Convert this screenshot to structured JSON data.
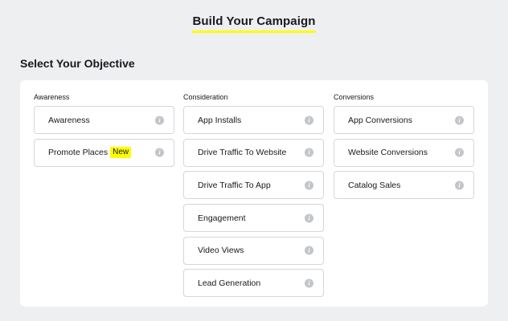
{
  "header": {
    "title": "Build Your Campaign"
  },
  "section": {
    "title": "Select Your Objective"
  },
  "columns": [
    {
      "label": "Awareness",
      "options": [
        {
          "label": "Awareness"
        },
        {
          "label": "Promote Places",
          "badge": "New"
        }
      ]
    },
    {
      "label": "Consideration",
      "options": [
        {
          "label": "App Installs"
        },
        {
          "label": "Drive Traffic To Website"
        },
        {
          "label": "Drive Traffic To App"
        },
        {
          "label": "Engagement"
        },
        {
          "label": "Video Views"
        },
        {
          "label": "Lead Generation"
        }
      ]
    },
    {
      "label": "Conversions",
      "options": [
        {
          "label": "App Conversions"
        },
        {
          "label": "Website Conversions"
        },
        {
          "label": "Catalog Sales"
        }
      ]
    }
  ],
  "icons": {
    "info": "i"
  },
  "colors": {
    "accent": "#fffc00",
    "background": "#eeeff1",
    "border": "#d4d6da"
  }
}
